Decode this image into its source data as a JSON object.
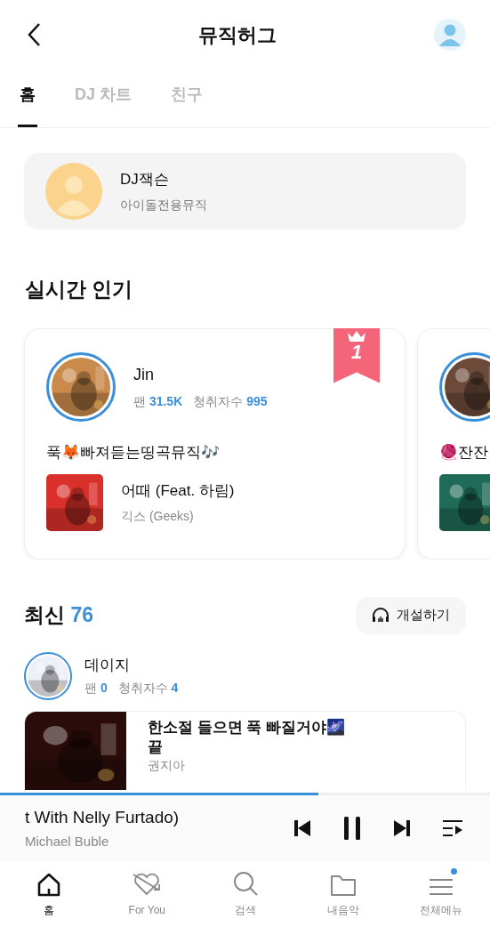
{
  "header": {
    "title": "뮤직허그"
  },
  "tabs": [
    {
      "label": "홈",
      "selected": true
    },
    {
      "label": "DJ 차트",
      "selected": false
    },
    {
      "label": "친구",
      "selected": false
    }
  ],
  "profile": {
    "name": "DJ잭슨",
    "subtitle": "아이돌전용뮤직"
  },
  "popular": {
    "title": "실시간 인기",
    "cards": [
      {
        "rank": "1",
        "dj": "Jin",
        "fans_label": "팬",
        "fans": "31.5K",
        "listeners_label": "청취자수",
        "listeners": "995",
        "playlist": "푹🦊빠져듣는띵곡뮤직🎶",
        "song": "어때 (Feat. 하림)",
        "artist": "긱스 (Geeks)"
      },
      {
        "playlist": "🧶잔잔"
      }
    ]
  },
  "latest": {
    "title": "최신",
    "count": "76",
    "create_button": "개설하기",
    "dj": {
      "name": "데이지",
      "fans_label": "팬",
      "fans": "0",
      "listeners_label": "청취자수",
      "listeners": "4"
    },
    "song": {
      "title": "한소절 들으면 푹 빠질거야🌌",
      "subtitle": "끝",
      "artist": "권지아"
    }
  },
  "player": {
    "title": "t With Nelly Furtado)",
    "artist": "Michael Buble",
    "level": 0.65
  },
  "nav": [
    {
      "label": "홈",
      "selected": true,
      "badge": false
    },
    {
      "label": "For You",
      "selected": false,
      "badge": false
    },
    {
      "label": "검색",
      "selected": false,
      "badge": false
    },
    {
      "label": "내음악",
      "selected": false,
      "badge": false
    },
    {
      "label": "전체메뉴",
      "selected": false,
      "badge": true
    }
  ]
}
